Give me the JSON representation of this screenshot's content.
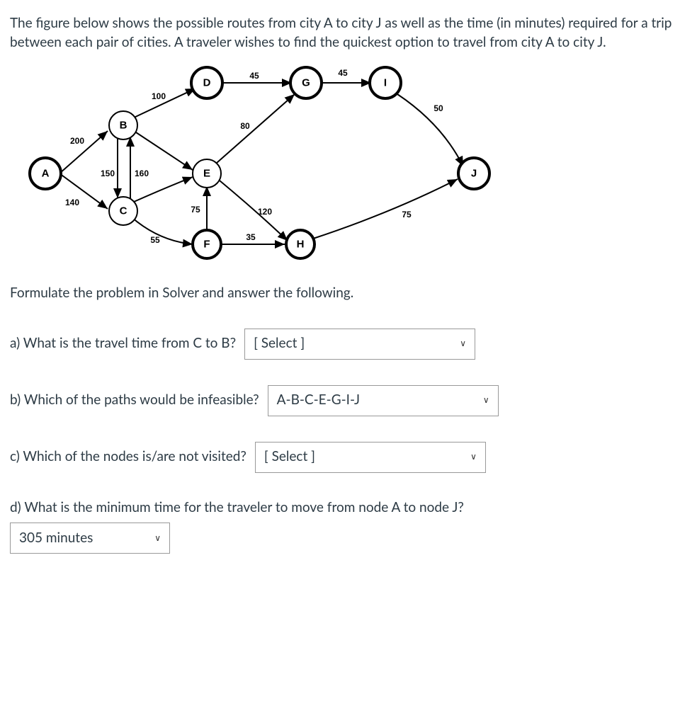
{
  "intro": "The figure below shows the possible routes from city A to city J as well as the time (in minutes) required for a trip between each pair of cities.  A traveler wishes to find the quickest option to travel from city A to city J.",
  "graph": {
    "nodes": {
      "A": "A",
      "B": "B",
      "C": "C",
      "D": "D",
      "E": "E",
      "F": "F",
      "G": "G",
      "H": "H",
      "I": "I",
      "J": "J"
    },
    "edges": {
      "AB": "200",
      "AC": "140",
      "BC_left": "150",
      "BC_right": "160",
      "BD": "100",
      "BE": "",
      "CE": "",
      "CF": "55",
      "DG": "45",
      "EG": "80",
      "EF": "75",
      "EH": "120",
      "FH": "35",
      "GI": "45",
      "IJ": "50",
      "HJ": "75"
    }
  },
  "prompt": "Formulate the problem in Solver and answer the following.",
  "qa": {
    "a_label": "a)  What is the travel time from C to B?",
    "a_value": "[ Select ]",
    "b_label": "b)  Which of the paths would be infeasible?",
    "b_value": "A-B-C-E-G-I-J",
    "c_label": "c)  Which of the nodes is/are not visited?",
    "c_value": "[ Select ]",
    "d_label": "d)  What is the minimum time for the traveler to move from node A to node J?",
    "d_value": "305 minutes"
  },
  "chart_data": {
    "type": "table",
    "title": "Directed travel-time graph from city A to city J (minutes)",
    "nodes": [
      "A",
      "B",
      "C",
      "D",
      "E",
      "F",
      "G",
      "H",
      "I",
      "J"
    ],
    "edges": [
      {
        "from": "A",
        "to": "B",
        "weight": 200
      },
      {
        "from": "A",
        "to": "C",
        "weight": 140
      },
      {
        "from": "B",
        "to": "C",
        "weight": 150
      },
      {
        "from": "C",
        "to": "B",
        "weight": 160
      },
      {
        "from": "B",
        "to": "D",
        "weight": 100
      },
      {
        "from": "B",
        "to": "E",
        "weight": null
      },
      {
        "from": "C",
        "to": "E",
        "weight": null
      },
      {
        "from": "C",
        "to": "F",
        "weight": 55
      },
      {
        "from": "D",
        "to": "G",
        "weight": 45
      },
      {
        "from": "E",
        "to": "G",
        "weight": 80
      },
      {
        "from": "F",
        "to": "E",
        "weight": 75
      },
      {
        "from": "E",
        "to": "H",
        "weight": 120
      },
      {
        "from": "F",
        "to": "H",
        "weight": 35
      },
      {
        "from": "G",
        "to": "I",
        "weight": 45
      },
      {
        "from": "I",
        "to": "J",
        "weight": 50
      },
      {
        "from": "H",
        "to": "J",
        "weight": 75
      }
    ]
  }
}
